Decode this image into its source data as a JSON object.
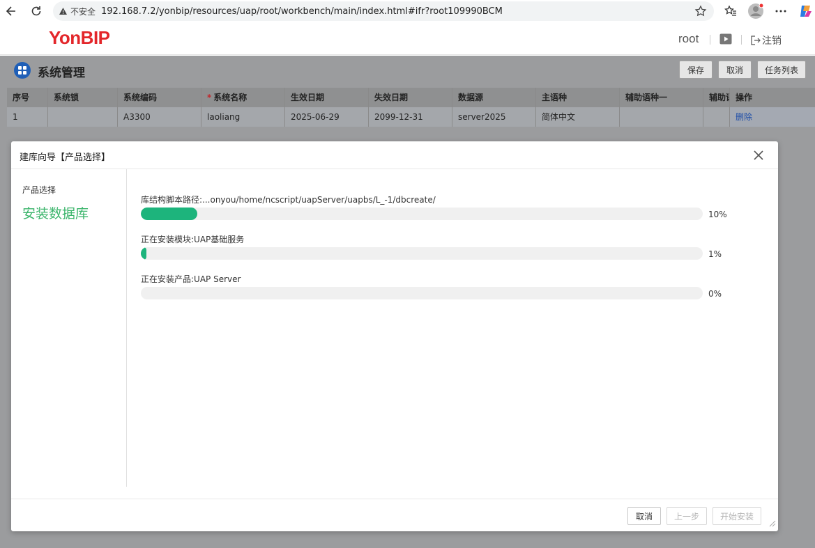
{
  "browser": {
    "insecure_label": "不安全",
    "url": "192.168.7.2/yonbip/resources/uap/root/workbench/main/index.html#ifr?root109990BCM"
  },
  "header": {
    "logo": "YonBIP",
    "user": "root",
    "logout_label": "注销"
  },
  "page": {
    "title": "系统管理",
    "buttons": {
      "save": "保存",
      "cancel": "取消",
      "tasks": "任务列表"
    }
  },
  "grid": {
    "columns": [
      "序号",
      "系统锁",
      "系统编码",
      "系统名称",
      "生效日期",
      "失效日期",
      "数据源",
      "主语种",
      "辅助语种一",
      "辅助语",
      "操作"
    ],
    "rows": [
      [
        "1",
        "",
        "A3300",
        "laoliang",
        "2025-06-29",
        "2099-12-31",
        "server2025",
        "简体中文",
        "",
        "",
        "删除"
      ]
    ]
  },
  "dialog": {
    "title": "建库向导【产品选择】",
    "steps": [
      "产品选择",
      "安装数据库"
    ],
    "progress": [
      {
        "label": "库结构脚本路径:...onyou/home/ncscript/uapServer/uapbs/L_-1/dbcreate/",
        "percent": 10,
        "percent_text": "10%"
      },
      {
        "label": "正在安装模块:UAP基础服务",
        "percent": 1,
        "percent_text": "1%"
      },
      {
        "label": "正在安装产品:UAP Server",
        "percent": 0,
        "percent_text": "0%"
      }
    ],
    "footer": {
      "cancel": "取消",
      "prev": "上一步",
      "start": "开始安装"
    }
  },
  "colors": {
    "accent_green": "#1db47c",
    "step_green": "#3bb56b",
    "brand_red": "#e3262a",
    "link_blue": "#1f4ea8"
  }
}
